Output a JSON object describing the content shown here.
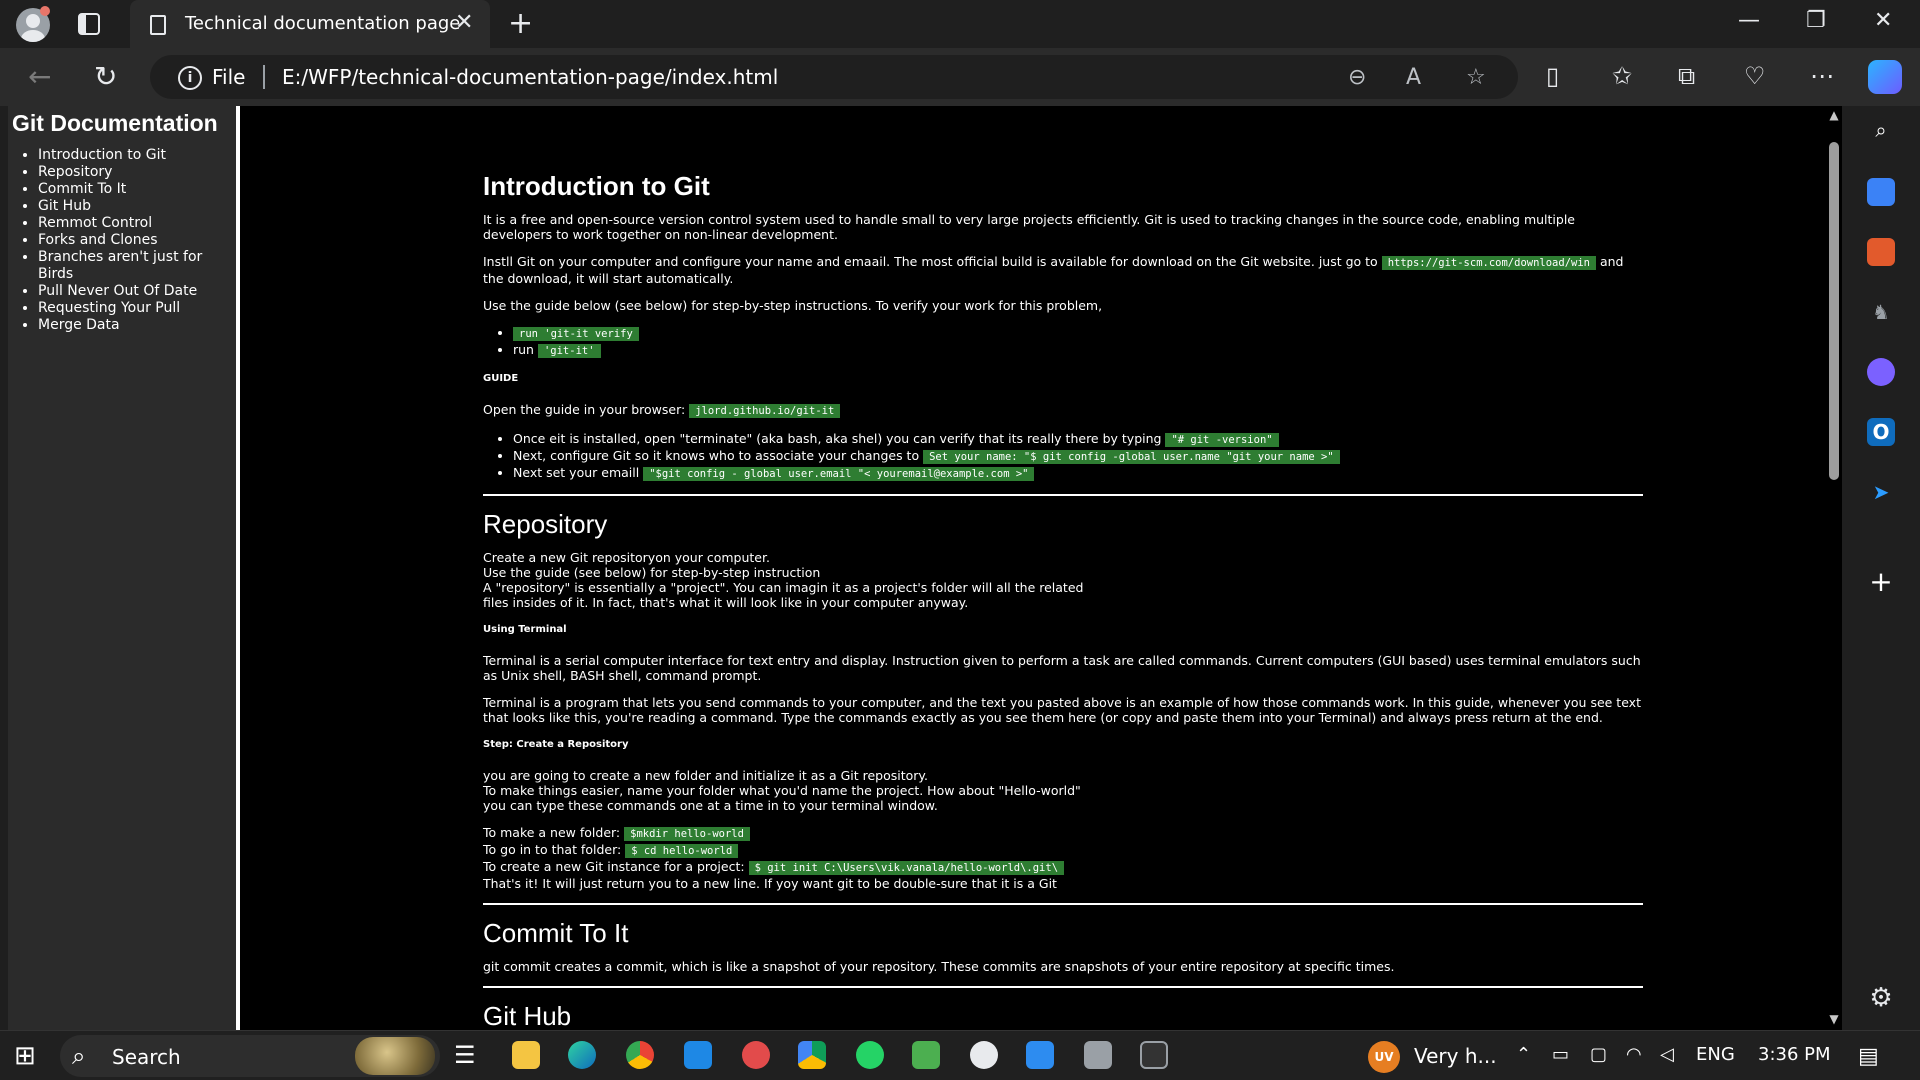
{
  "browser": {
    "tab_title": "Technical documentation page",
    "address_prefix": "File",
    "url": "E:/WFP/technical-documentation-page/index.html"
  },
  "nav": {
    "title": "Git Documentation",
    "items": [
      "Introduction to Git",
      "Repository",
      "Commit To It",
      "Git Hub",
      "Remmot Control",
      "Forks and Clones",
      "Branches aren't just for Birds",
      "Pull Never Out Of Date",
      "Requesting Your Pull",
      "Merge Data"
    ]
  },
  "intro": {
    "heading": "Introduction to Git",
    "p1": "It is a free and open-source version control system used to handle small to very large projects efficiently. Git is used to tracking changes in the source code, enabling multiple developers to work together on non-linear development.",
    "p2_before": "Instll Git on your computer and configure your name and emaail. The most official build is available for download on the Git website. just go to",
    "p2_code": "https://git-scm.com/download/win",
    "p2_after": "and the download, it will start automatically.",
    "p3": "Use the guide below (see below) for step-by-step instructions. To verify your work for this problem,",
    "list1_item1_code": "run 'git-it verify",
    "list1_item2_text": "run",
    "list1_item2_code": "'git-it'",
    "guide_label": "GUIDE",
    "guide_p_before": "Open the guide in your browser:",
    "guide_p_code": "jlord.github.io/git-it",
    "list2_item1_text": "Once eit is installed, open \"terminate\" (aka bash, aka shel) you can verify that its really there by typing",
    "list2_item1_code": "\"# git -version\"",
    "list2_item2_text": "Next, configure Git so it knows who to associate your changes to",
    "list2_item2_code": "Set your name: \"$ git config -global user.name \"git your name >\"",
    "list2_item3_text": "Next set your emaill",
    "list2_item3_code": "\"$git config - global user.email \"< youremail@example.com >\""
  },
  "repository": {
    "heading": "Repository",
    "line1": "Create a new Git repositoryon your computer.",
    "line2": "Use the guide (see below) for step-by-step instruction",
    "line3": "A \"repository\" is essentially a \"project\". You can imagin it as a project's folder will all the related",
    "line4": "files insides of it. In fact, that's what it will look like in your computer anyway.",
    "terminal_label": "Using Terminal",
    "terminal_p1": "Terminal is a serial computer interface for text entry and display. Instruction given to perform a task are called commands. Current computers (GUI based) uses terminal emulators such as Unix shell, BASH shell, command prompt.",
    "terminal_p2": "Terminal is a program that lets you send commands to your computer, and the text you pasted above is an example of how those commands work. In this guide, whenever you see text that looks like this, you're reading a command. Type the commands exactly as you see them here (or copy and paste them into your Terminal) and always press return at the end.",
    "step_label": "Step: Create a Repository",
    "step_line1": "you are going to create a new folder and initialize it as a Git repository.",
    "step_line2": "To make things easier, name your folder what you'd name the project. How about \"Hello-world\"",
    "step_line3": "you can type these commands one at a time in to your terminal window.",
    "cmd1_text": "To make a new folder:",
    "cmd1_code": "$mkdir hello-world",
    "cmd2_text": "To go in to that folder:",
    "cmd2_code": "$ cd hello-world",
    "cmd3_text": "To create a new Git instance for a project:",
    "cmd3_code": "$ git init C:\\Users\\vik.vanala/hello-world\\.git\\",
    "cmd4_text": "That's it! It will just return you to a new line. If yoy want git to be double-sure that it is a Git"
  },
  "commit": {
    "heading": "Commit To It",
    "p1": "git commit creates a commit, which is like a snapshot of your repository. These commits are snapshots of your entire repository at specific times."
  },
  "github": {
    "heading": "Git Hub"
  },
  "taskbar": {
    "search_label": "Search",
    "weather_text": "Very h...",
    "weather_badge": "UV",
    "language": "ENG",
    "time": "3:36 PM"
  },
  "colors": {
    "code_bg": "#2e7d32",
    "nav_bg": "#2b2b2b",
    "page_bg": "#000000",
    "chrome_bg": "#1f1f1f"
  }
}
